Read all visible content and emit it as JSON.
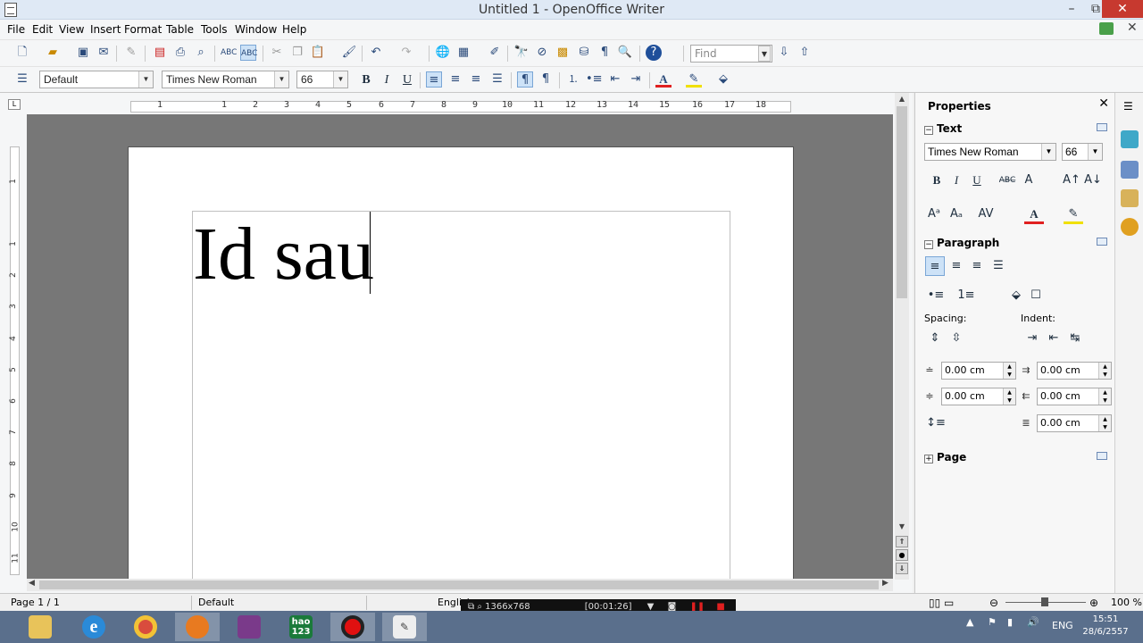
{
  "window": {
    "title": "Untitled 1 - OpenOffice Writer",
    "minimize_glyph": "–",
    "restore_glyph": "⧉",
    "close_glyph": "✕"
  },
  "menu": [
    "File",
    "Edit",
    "View",
    "Insert",
    "Format",
    "Table",
    "Tools",
    "Window",
    "Help"
  ],
  "find": {
    "placeholder": "Find"
  },
  "format_bar": {
    "paragraph_style": "Default",
    "font_name": "Times New Roman",
    "font_size": "66",
    "bold": "B",
    "italic": "I",
    "underline": "U"
  },
  "ruler": {
    "h_ticks": [
      "1",
      "1",
      "2",
      "3",
      "4",
      "5",
      "6",
      "7",
      "8",
      "9",
      "10",
      "11",
      "12",
      "13",
      "14",
      "15",
      "16",
      "17",
      "18"
    ],
    "v_ticks": [
      "1",
      "1",
      "2",
      "3",
      "4",
      "5",
      "6",
      "7",
      "8",
      "9",
      "10",
      "11"
    ]
  },
  "document": {
    "text": "Id sau"
  },
  "sidebar": {
    "title": "Properties",
    "close_glyph": "✕",
    "text_section": {
      "title": "Text",
      "font_name": "Times New Roman",
      "font_size": "66",
      "bold": "B",
      "italic": "I",
      "underline": "U"
    },
    "paragraph_section": {
      "title": "Paragraph",
      "spacing_label": "Spacing:",
      "indent_label": "Indent:",
      "above_spacing": "0.00 cm",
      "below_spacing": "0.00 cm",
      "before_indent": "0.00 cm",
      "after_indent": "0.00 cm",
      "first_line_indent": "0.00 cm"
    },
    "page_section": {
      "title": "Page"
    }
  },
  "status": {
    "page": "Page 1 / 1",
    "style": "Default",
    "language": "English",
    "zoom": "100 %"
  },
  "recording_overlay": {
    "resolution": "1366x768",
    "status": "[00:01:26]"
  },
  "taskbar": {
    "apps": [
      "File Explorer",
      "Internet Explorer",
      "Chrome",
      "Firefox",
      "WinRAR",
      "hao123",
      "Recorder",
      "OpenOffice Writer"
    ],
    "hao_label": "hao\n123",
    "language": "ENG",
    "time": "15:51",
    "date": "28/6/2557"
  },
  "colors": {
    "titlebar": "#dfe9f5",
    "close_button": "#c7392f",
    "workspace_bg": "#777777",
    "taskbar": "#5a6f8c",
    "active_toggle": "#cde2f7"
  }
}
